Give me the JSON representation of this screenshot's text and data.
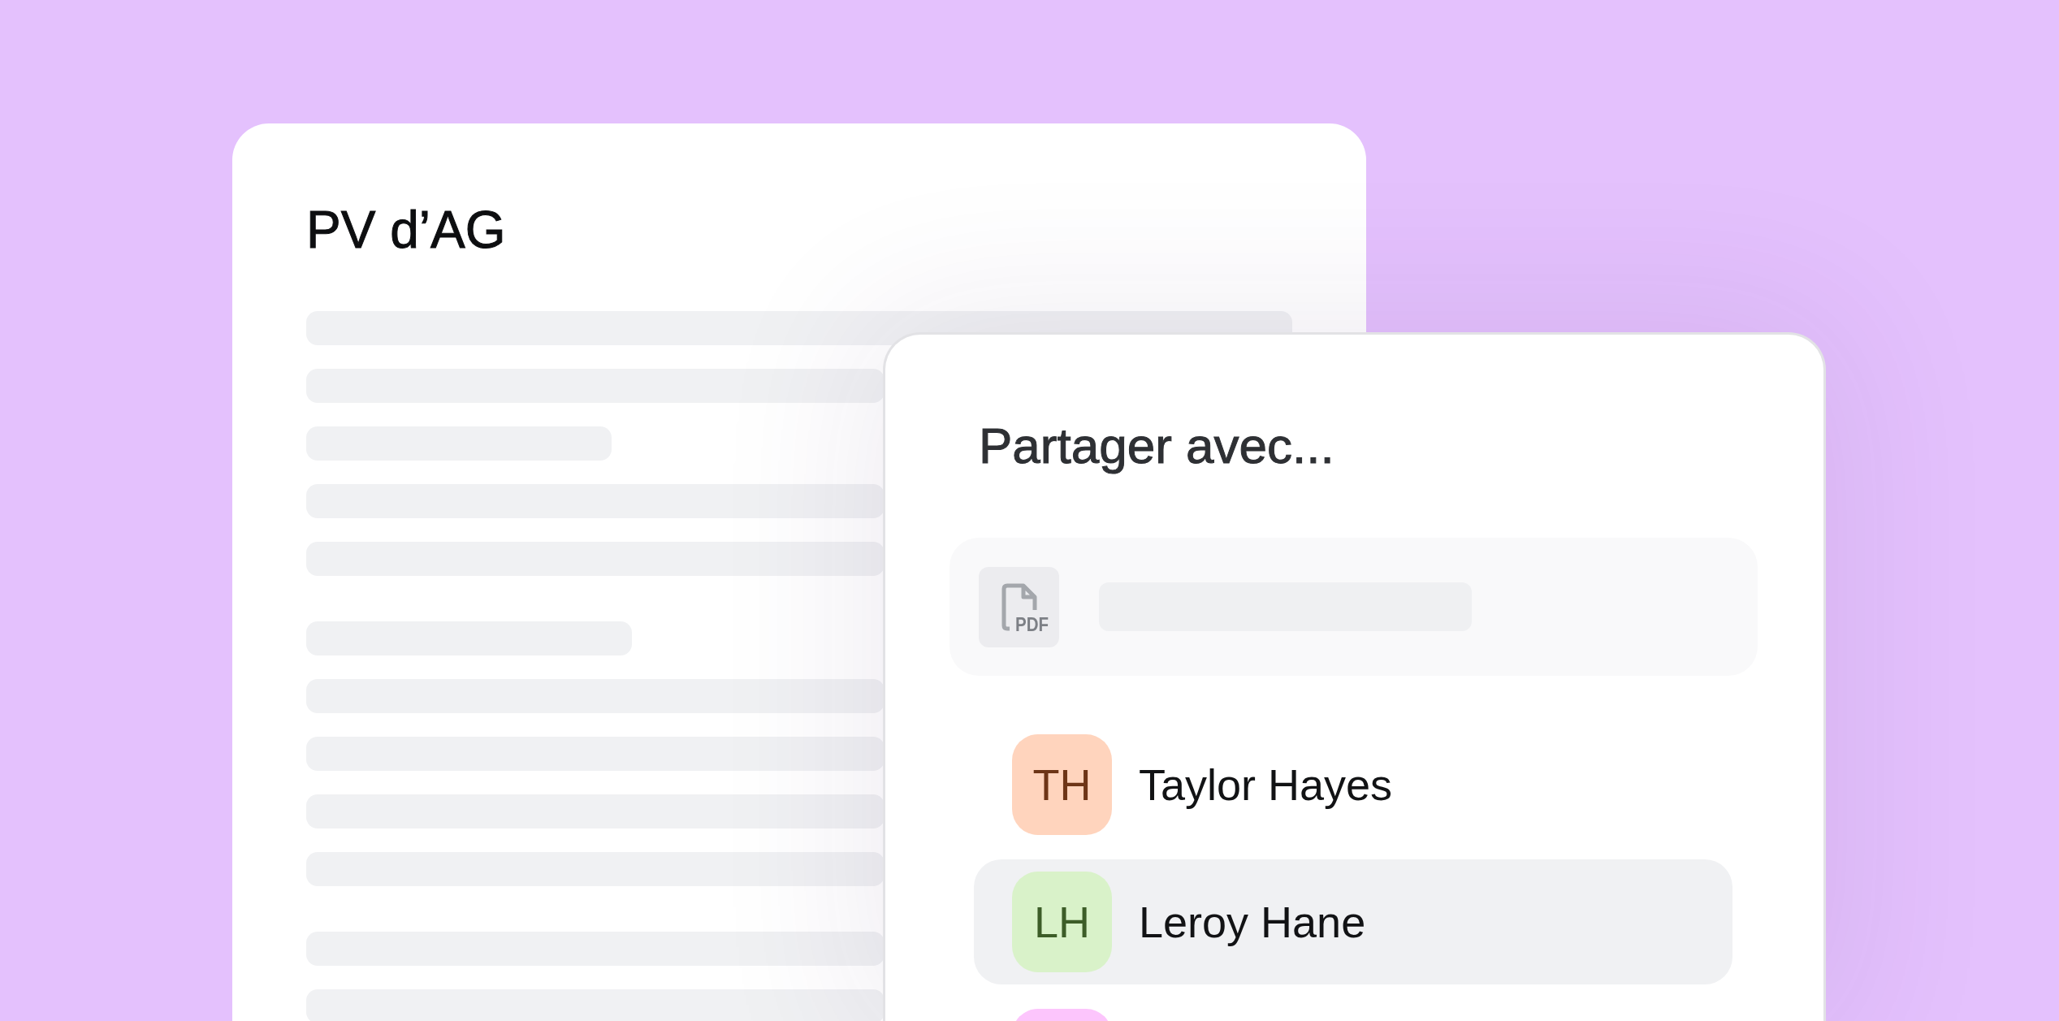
{
  "document": {
    "title": "PV d’AG"
  },
  "share_dialog": {
    "title": "Partager avec...",
    "file": {
      "type_label": "PDF"
    },
    "contacts": [
      {
        "initials": "TH",
        "name": "Taylor Hayes",
        "color": "#ffd4bd",
        "selected": false
      },
      {
        "initials": "LH",
        "name": "Leroy Hane",
        "color": "#d9f2c9",
        "selected": true
      },
      {
        "color": "#fcc5fc",
        "selected": false
      }
    ]
  }
}
